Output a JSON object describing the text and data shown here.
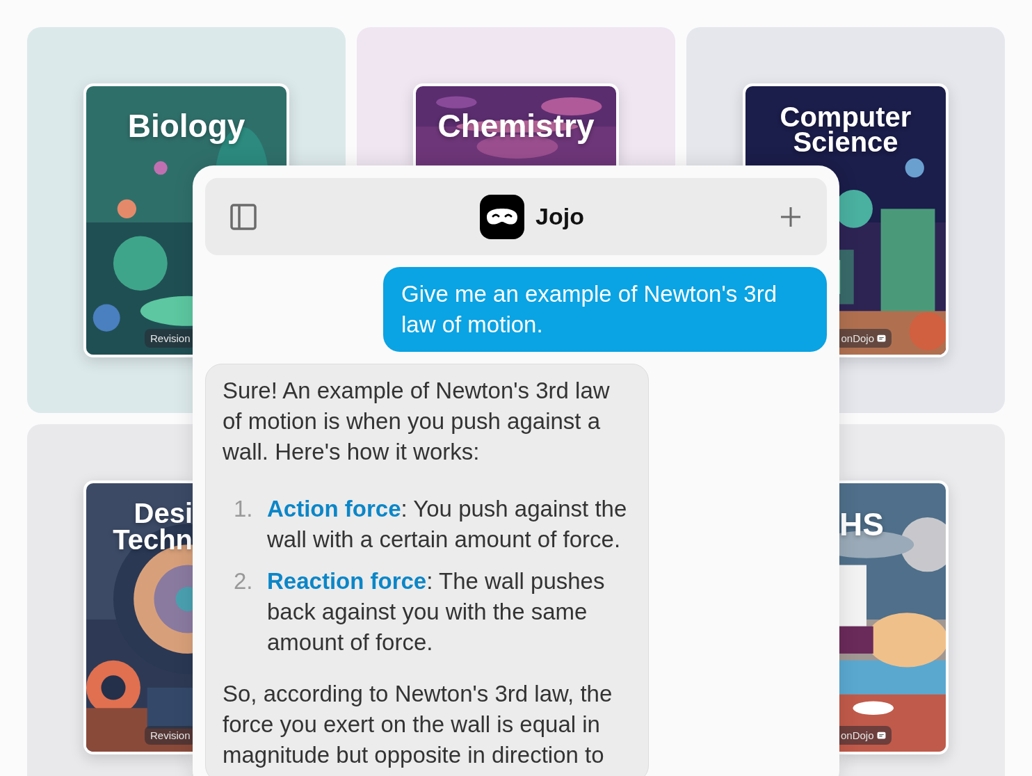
{
  "cards": [
    {
      "title": "Biology",
      "kind": "picture",
      "badge": "Revision"
    },
    {
      "title": "Chemistry",
      "kind": "picture"
    },
    {
      "title": "Computer\nScience",
      "kind": "picture",
      "badge": "onDojo"
    },
    {
      "title": "Desi\nTechn",
      "kind": "picture",
      "badge": "Revision"
    },
    {
      "title": "HS",
      "kind": "picture",
      "badge": "onDojo"
    }
  ],
  "chat": {
    "title": "Jojo",
    "user_message": "Give me an example of Newton's 3rd law of motion.",
    "assistant_message": {
      "intro": "Sure! An example of Newton's 3rd law of motion is when you push against a wall. Here's how it works:",
      "points": [
        {
          "number": "1.",
          "term": "Action force",
          "text": ": You push against the wall with a certain amount of force."
        },
        {
          "number": "2.",
          "term": "Reaction force",
          "text": ": The wall pushes back against you with the same amount of force."
        }
      ],
      "conclusion": "So, according to Newton's 3rd law, the force you exert on the wall is equal in magnitude but opposite in direction to"
    }
  }
}
